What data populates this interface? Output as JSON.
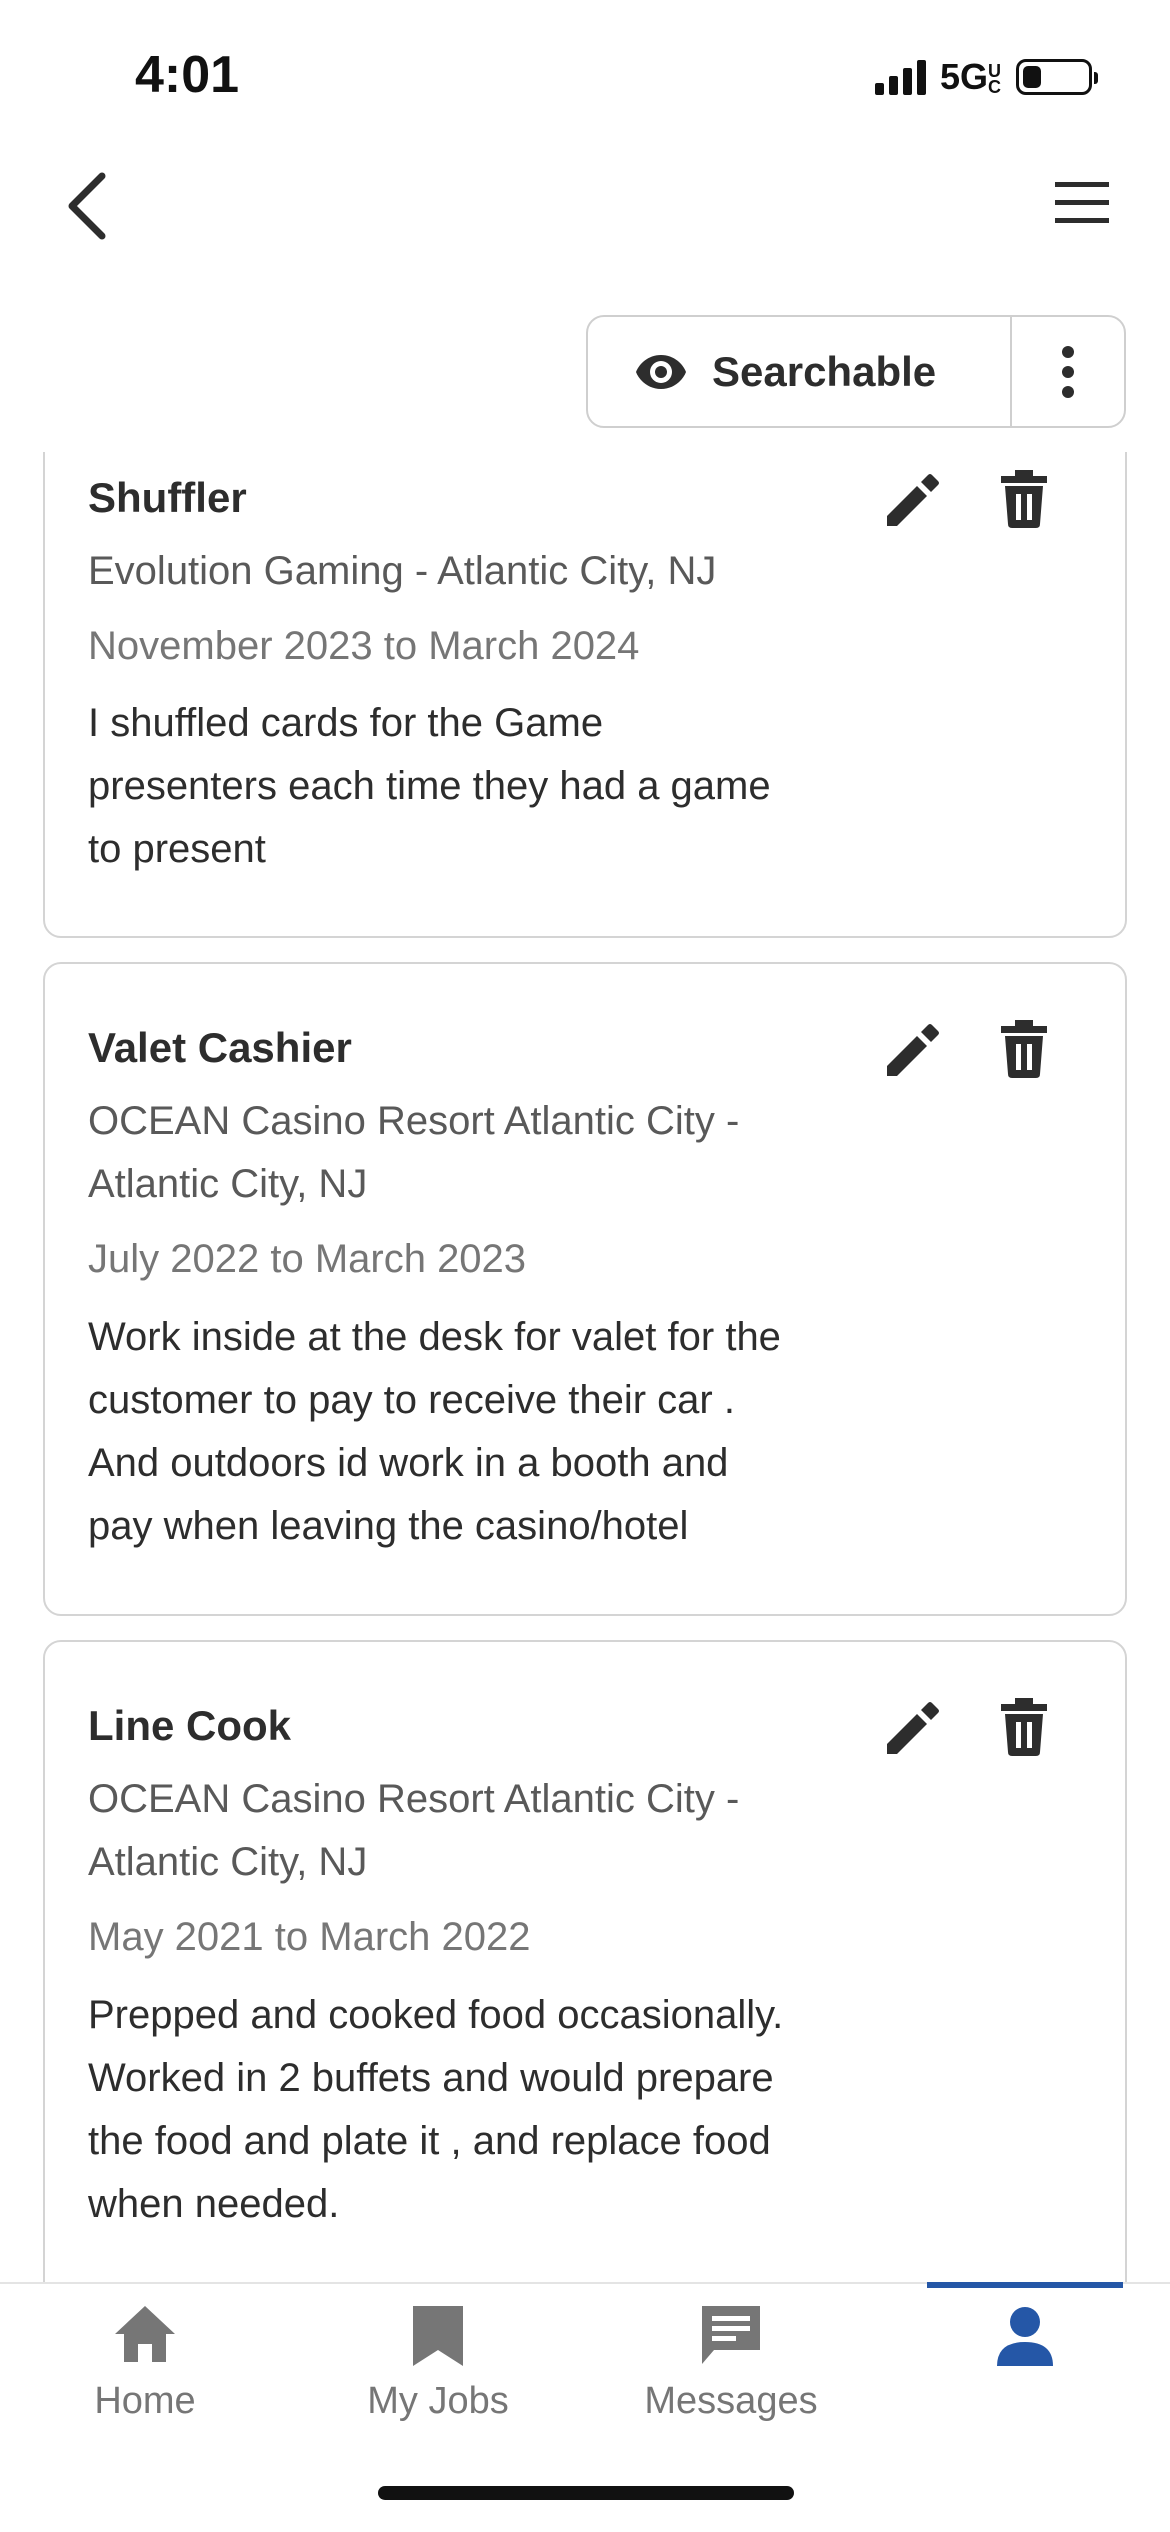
{
  "status_bar": {
    "time": "4:01",
    "network": "5G",
    "network_sub": "UC"
  },
  "header": {
    "back_icon": "chevron-left-icon",
    "menu_icon": "hamburger-icon"
  },
  "visibility": {
    "label": "Searchable",
    "icon": "eye-icon",
    "more_icon": "more-vertical-icon"
  },
  "experiences": [
    {
      "title": "Shuffler",
      "company_lines": [
        "Evolution Gaming - Atlantic City, NJ"
      ],
      "dates": "November 2023 to March 2024",
      "description_lines": [
        "I shuffled cards for the Game",
        "presenters each time they had a game",
        "to present"
      ]
    },
    {
      "title": "Valet Cashier",
      "company_lines": [
        "OCEAN Casino Resort Atlantic City -",
        "Atlantic City, NJ"
      ],
      "dates": "July 2022 to March 2023",
      "description_lines": [
        "Work inside at the desk for valet for the",
        "customer to pay to receive their car .",
        "And outdoors id work in a booth and",
        "pay when leaving the casino/hotel"
      ]
    },
    {
      "title": "Line Cook",
      "company_lines": [
        "OCEAN Casino Resort Atlantic City -",
        "Atlantic City, NJ"
      ],
      "dates": "May 2021 to March 2022",
      "description_lines": [
        "Prepped and cooked food occasionally.",
        "Worked in 2 buffets and would prepare",
        "the food and plate it , and replace food",
        "when needed."
      ]
    }
  ],
  "bottom_nav": {
    "tabs": [
      {
        "label": "Home",
        "icon": "home-icon"
      },
      {
        "label": "My Jobs",
        "icon": "bookmark-icon"
      },
      {
        "label": "Messages",
        "icon": "message-icon"
      },
      {
        "label": "",
        "icon": "profile-icon",
        "active": true
      }
    ]
  },
  "colors": {
    "accent": "#2557a7",
    "text": "#2d2d2d",
    "muted": "#767676",
    "border": "#d4d4d4"
  }
}
